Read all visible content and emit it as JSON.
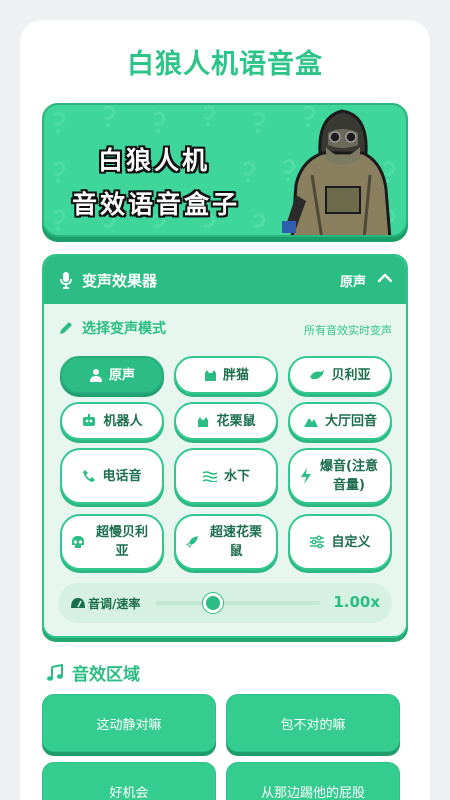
{
  "app": {
    "title": "白狼人机语音盒"
  },
  "banner": {
    "line1": "白狼人机",
    "line2": "音效语音盒子"
  },
  "effects": {
    "header_title": "变声效果器",
    "current": "原声",
    "mode_label": "选择变声模式",
    "mode_hint": "所有音效实时变声",
    "buttons": [
      {
        "label": "原声",
        "icon": "person-icon",
        "active": true
      },
      {
        "label": "胖猫",
        "icon": "cat-icon",
        "active": false
      },
      {
        "label": "贝利亚",
        "icon": "dolphin-icon",
        "active": false
      },
      {
        "label": "机器人",
        "icon": "robot-icon",
        "active": false
      },
      {
        "label": "花栗鼠",
        "icon": "squirrel-icon",
        "active": false
      },
      {
        "label": "大厅回音",
        "icon": "mountain-icon",
        "active": false
      },
      {
        "label": "电话音",
        "icon": "phone-icon",
        "active": false
      },
      {
        "label": "水下",
        "icon": "water-icon",
        "active": false
      },
      {
        "label": "爆音(注意音量)",
        "icon": "lightning-icon",
        "active": false
      },
      {
        "label": "超慢贝利亚",
        "icon": "skull-icon",
        "active": false
      },
      {
        "label": "超速花栗鼠",
        "icon": "rocket-icon",
        "active": false
      },
      {
        "label": "自定义",
        "icon": "sliders-icon",
        "active": false
      }
    ],
    "pitch": {
      "label": "音调/速率",
      "value_text": "1.00x",
      "position": 0.35
    }
  },
  "sounds": {
    "section_title": "音效区域",
    "items": [
      "这动静对嘛",
      "包不对的嘛",
      "好机会",
      "从那边踢他的屁股"
    ]
  },
  "colors": {
    "accent": "#2bbd84",
    "accent_dark": "#1e9c69",
    "background": "#eef0f1"
  }
}
